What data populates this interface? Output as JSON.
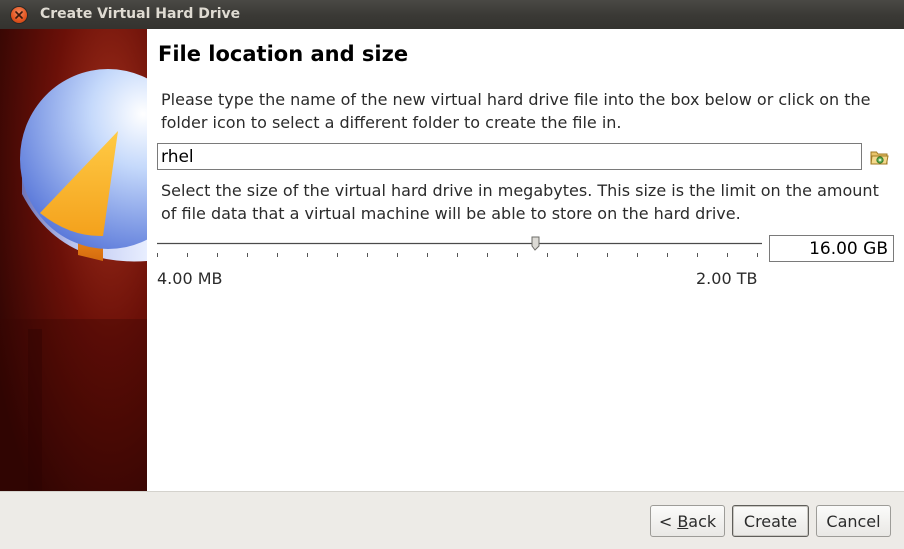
{
  "window": {
    "title": "Create Virtual Hard Drive"
  },
  "page": {
    "heading": "File location and size",
    "location_description": "Please type the name of the new virtual hard drive file into the box below or click on the folder icon to select a different folder to create the file in.",
    "file_name_value": "rhel",
    "size_description": "Select the size of the virtual hard drive in megabytes. This size is the limit on the amount of file data that a virtual machine will be able to store on the hard drive.",
    "size_value": "16.00 GB",
    "slider": {
      "min_label": "4.00 MB",
      "max_label": "2.00 TB",
      "position_fraction": 0.63
    }
  },
  "buttons": {
    "back_prefix": "< ",
    "back_accel": "B",
    "back_rest": "ack",
    "create": "Create",
    "cancel": "Cancel"
  },
  "colors": {
    "titlebar": "#3c3b37",
    "close_button": "#e2541f",
    "sidebar_bg": "#6b1008",
    "footer_bg": "#edebe7"
  },
  "icons": {
    "close": "close-icon",
    "folder": "folder-icon",
    "sidebar": "hard-disk-icon"
  }
}
